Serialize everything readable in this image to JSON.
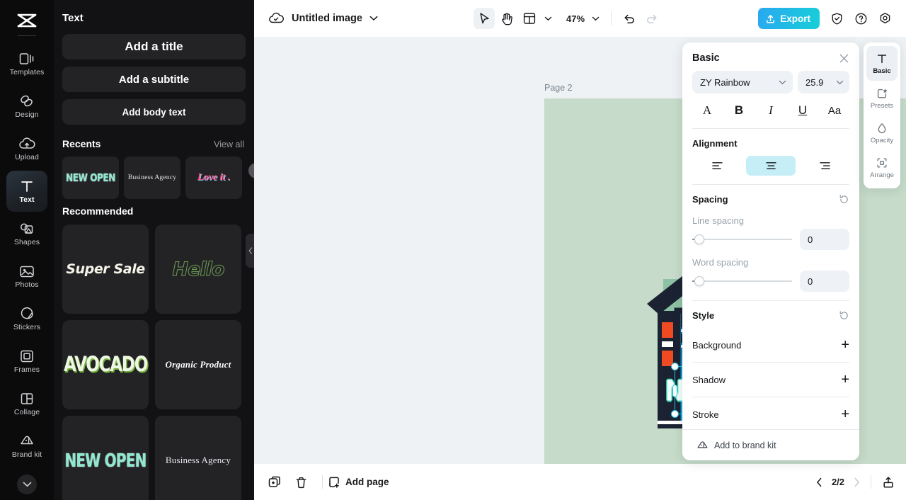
{
  "rail": {
    "logo_icon": "capcut-logo-icon",
    "items": [
      {
        "label": "Templates",
        "icon": "templates-icon",
        "active": false
      },
      {
        "label": "Design",
        "icon": "design-icon",
        "active": false
      },
      {
        "label": "Upload",
        "icon": "upload-cloud-icon",
        "active": false
      },
      {
        "label": "Text",
        "icon": "text-t-icon",
        "active": true
      },
      {
        "label": "Shapes",
        "icon": "shapes-icon",
        "active": false
      },
      {
        "label": "Photos",
        "icon": "photos-icon",
        "active": false
      },
      {
        "label": "Stickers",
        "icon": "stickers-icon",
        "active": false
      },
      {
        "label": "Frames",
        "icon": "frames-icon",
        "active": false
      },
      {
        "label": "Collage",
        "icon": "collage-icon",
        "active": false
      },
      {
        "label": "Brand kit",
        "icon": "brand-kit-icon",
        "active": false
      }
    ],
    "expand_icon": "chevron-down-icon"
  },
  "panel": {
    "title": "Text",
    "add_title": "Add a title",
    "add_subtitle": "Add a subtitle",
    "add_body": "Add body text",
    "recents_heading": "Recents",
    "recents_view_all": "View all",
    "recents": [
      {
        "text": "NEW OPEN",
        "style": "t-newopen"
      },
      {
        "text": "Business Agency",
        "style": "t-bizagency"
      },
      {
        "text": "Love it .",
        "style": "t-loveit"
      }
    ],
    "recents_next_icon": "chevron-right-icon",
    "recommended_heading": "Recommended",
    "recommended": [
      {
        "text": "Super Sale",
        "style": "t-supersale"
      },
      {
        "text": "Hello",
        "style": "t-hello"
      },
      {
        "text": "AVOCADO",
        "style": "t-avocado"
      },
      {
        "text": "Organic Product",
        "style": "t-organic"
      },
      {
        "text": "NEW OPEN",
        "style": "t-newopen2"
      },
      {
        "text": "Business Agency",
        "style": "t-bizagency2"
      }
    ],
    "collapse_icon": "chevron-left-icon"
  },
  "topbar": {
    "cloud_icon": "cloud-saved-icon",
    "doc_title": "Untitled image",
    "title_caret_icon": "chevron-down-icon",
    "select_tool_icon": "cursor-arrow-icon",
    "hand_tool_icon": "hand-icon",
    "layout_tool_icon": "layout-panels-icon",
    "layout_caret_icon": "chevron-down-icon",
    "zoom": "47%",
    "zoom_caret_icon": "chevron-down-icon",
    "undo_icon": "undo-icon",
    "redo_icon": "redo-icon",
    "export_label": "Export",
    "export_icon": "upload-arrow-icon",
    "shield_icon": "shield-check-icon",
    "help_icon": "question-circle-icon",
    "settings_icon": "gear-icon"
  },
  "canvas": {
    "page_label": "Page 2",
    "duplicate_page_icon": "duplicate-image-icon",
    "page_more_icon": "more-dots-icon",
    "background_color": "#c6dbc9",
    "selected_text": "NEW OPEN",
    "float_duplicate_icon": "duplicate-icon",
    "float_more_icon": "more-dots-icon",
    "rotate_icon": "rotate-icon"
  },
  "bottombar": {
    "duplicate_icon": "duplicate-page-icon",
    "delete_icon": "trash-icon",
    "add_page_label": "Add page",
    "add_page_icon": "add-page-icon",
    "prev_icon": "chevron-left-icon",
    "page_count": "2/2",
    "next_icon": "chevron-right-icon",
    "export_page_icon": "export-page-icon"
  },
  "props": {
    "title": "Basic",
    "close_icon": "close-icon",
    "font_name": "ZY Rainbow",
    "font_caret_icon": "chevron-down-icon",
    "font_size": "25.9",
    "size_caret_icon": "chevron-down-icon",
    "format": [
      {
        "label": "A",
        "name": "font-color-button"
      },
      {
        "label": "B",
        "name": "bold-button"
      },
      {
        "label": "I",
        "name": "italic-button"
      },
      {
        "label": "U",
        "name": "underline-button"
      },
      {
        "label": "Aa",
        "name": "letter-case-button"
      }
    ],
    "alignment_label": "Alignment",
    "alignments": [
      {
        "name": "align-left-button",
        "active": false
      },
      {
        "name": "align-center-button",
        "active": true
      },
      {
        "name": "align-right-button",
        "active": false
      }
    ],
    "spacing_label": "Spacing",
    "spacing_reset_icon": "reset-icon",
    "line_spacing_label": "Line spacing",
    "line_spacing_value": "0",
    "word_spacing_label": "Word spacing",
    "word_spacing_value": "0",
    "style_label": "Style",
    "style_reset_icon": "reset-icon",
    "style_rows": [
      {
        "label": "Background",
        "name": "background-row"
      },
      {
        "label": "Shadow",
        "name": "shadow-row"
      },
      {
        "label": "Stroke",
        "name": "stroke-row"
      }
    ],
    "brand_kit_label": "Add to brand kit",
    "brand_kit_icon": "brand-kit-icon",
    "accent_color": "#c6eef7"
  },
  "rtabs": [
    {
      "label": "Basic",
      "icon": "text-t-icon",
      "active": true
    },
    {
      "label": "Presets",
      "icon": "presets-star-icon",
      "active": false
    },
    {
      "label": "Opacity",
      "icon": "opacity-drop-icon",
      "active": false
    },
    {
      "label": "Arrange",
      "icon": "arrange-icon",
      "active": false
    }
  ]
}
